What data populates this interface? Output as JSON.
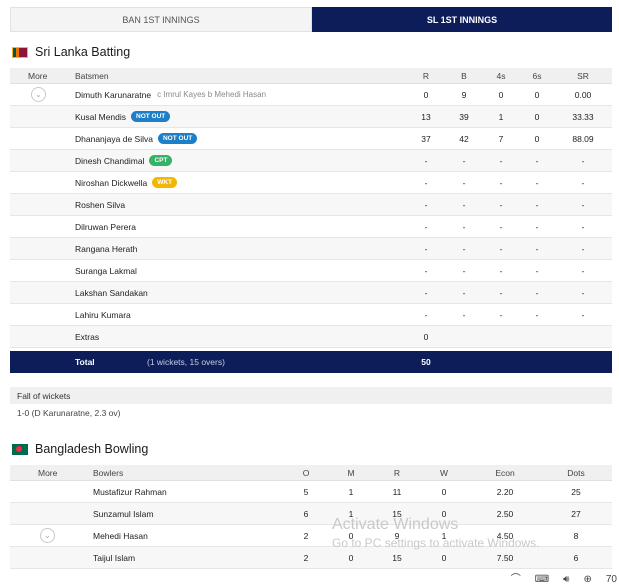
{
  "tabs": [
    {
      "label": "BAN 1ST INNINGS",
      "active": false
    },
    {
      "label": "SL 1ST INNINGS",
      "active": true
    }
  ],
  "batting": {
    "title": "Sri Lanka Batting",
    "headers": {
      "more": "More",
      "batsmen": "Batsmen",
      "r": "R",
      "b": "B",
      "fours": "4s",
      "sixes": "6s",
      "sr": "SR"
    },
    "rows": [
      {
        "name": "Dimuth Karunaratne",
        "badge": "",
        "dismissal": "c Imrul Kayes b Mehedi Hasan",
        "r": "0",
        "b": "9",
        "fours": "0",
        "sixes": "0",
        "sr": "0.00",
        "expand": true
      },
      {
        "name": "Kusal Mendis",
        "badge": "NOT OUT",
        "dismissal": "",
        "r": "13",
        "b": "39",
        "fours": "1",
        "sixes": "0",
        "sr": "33.33"
      },
      {
        "name": "Dhananjaya de Silva",
        "badge": "NOT OUT",
        "dismissal": "",
        "r": "37",
        "b": "42",
        "fours": "7",
        "sixes": "0",
        "sr": "88.09"
      },
      {
        "name": "Dinesh Chandimal",
        "badge": "CPT",
        "dismissal": "",
        "r": "-",
        "b": "-",
        "fours": "-",
        "sixes": "-",
        "sr": "-"
      },
      {
        "name": "Niroshan Dickwella",
        "badge": "WKT",
        "dismissal": "",
        "r": "-",
        "b": "-",
        "fours": "-",
        "sixes": "-",
        "sr": "-"
      },
      {
        "name": "Roshen Silva",
        "badge": "",
        "dismissal": "",
        "r": "-",
        "b": "-",
        "fours": "-",
        "sixes": "-",
        "sr": "-"
      },
      {
        "name": "Dilruwan Perera",
        "badge": "",
        "dismissal": "",
        "r": "-",
        "b": "-",
        "fours": "-",
        "sixes": "-",
        "sr": "-"
      },
      {
        "name": "Rangana Herath",
        "badge": "",
        "dismissal": "",
        "r": "-",
        "b": "-",
        "fours": "-",
        "sixes": "-",
        "sr": "-"
      },
      {
        "name": "Suranga Lakmal",
        "badge": "",
        "dismissal": "",
        "r": "-",
        "b": "-",
        "fours": "-",
        "sixes": "-",
        "sr": "-"
      },
      {
        "name": "Lakshan Sandakan",
        "badge": "",
        "dismissal": "",
        "r": "-",
        "b": "-",
        "fours": "-",
        "sixes": "-",
        "sr": "-"
      },
      {
        "name": "Lahiru Kumara",
        "badge": "",
        "dismissal": "",
        "r": "-",
        "b": "-",
        "fours": "-",
        "sixes": "-",
        "sr": "-"
      },
      {
        "name": "Extras",
        "badge": "",
        "dismissal": "",
        "r": "0",
        "b": "",
        "fours": "",
        "sixes": "",
        "sr": ""
      }
    ],
    "total": {
      "label": "Total",
      "detail": "(1 wickets, 15 overs)",
      "runs": "50"
    }
  },
  "fall_of_wickets": {
    "title": "Fall of wickets",
    "text": "1-0 (D Karunaratne, 2.3 ov)"
  },
  "bowling": {
    "title": "Bangladesh Bowling",
    "headers": {
      "more": "More",
      "bowlers": "Bowlers",
      "o": "O",
      "m": "M",
      "r": "R",
      "w": "W",
      "econ": "Econ",
      "dots": "Dots"
    },
    "rows": [
      {
        "name": "Mustafizur Rahman",
        "o": "5",
        "m": "1",
        "r": "11",
        "w": "0",
        "econ": "2.20",
        "dots": "25"
      },
      {
        "name": "Sunzamul Islam",
        "o": "6",
        "m": "1",
        "r": "15",
        "w": "0",
        "econ": "2.50",
        "dots": "27"
      },
      {
        "name": "Mehedi Hasan",
        "o": "2",
        "m": "0",
        "r": "9",
        "w": "1",
        "econ": "4.50",
        "dots": "8",
        "expand": true
      },
      {
        "name": "Taijul Islam",
        "o": "2",
        "m": "0",
        "r": "15",
        "w": "0",
        "econ": "7.50",
        "dots": "6"
      }
    ]
  },
  "watermark": {
    "line1": "Activate Windows",
    "line2": "Go to PC settings to activate Windows."
  },
  "taskbar": {
    "zoom": "70"
  },
  "icons": {
    "expand": "chevron-down-icon",
    "flag_sl": "sri-lanka-flag-icon",
    "flag_bd": "bangladesh-flag-icon"
  }
}
